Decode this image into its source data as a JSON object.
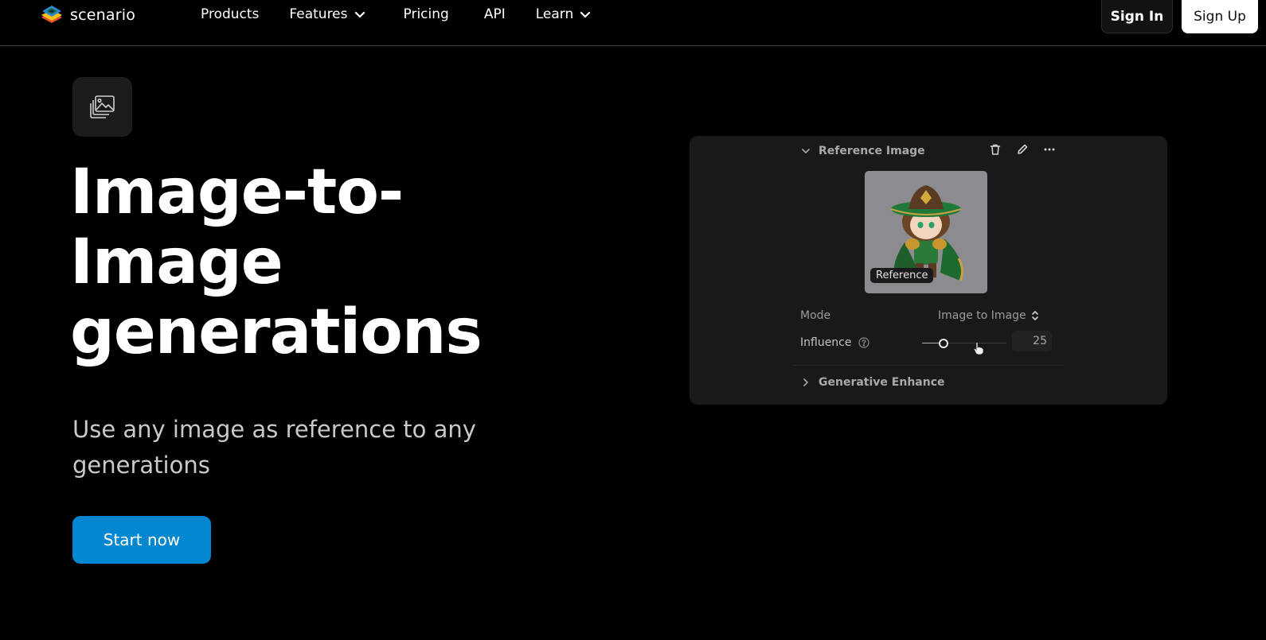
{
  "nav": {
    "brand": "scenario",
    "links": [
      {
        "label": "Products",
        "has_dropdown": false
      },
      {
        "label": "Features",
        "has_dropdown": true
      },
      {
        "label": "Pricing",
        "has_dropdown": false
      },
      {
        "label": "API",
        "has_dropdown": false
      },
      {
        "label": "Learn",
        "has_dropdown": true
      }
    ],
    "sign_in": "Sign In",
    "sign_up": "Sign Up"
  },
  "hero": {
    "feature_icon": "images-icon",
    "title": "Image-to-Image generations",
    "subtitle": "Use any image as reference to any generations",
    "cta": "Start now"
  },
  "preview": {
    "section_title": "Reference Image",
    "actions": [
      "trash-icon",
      "pencil-icon",
      "more-icon"
    ],
    "image_badge": "Reference",
    "mode_label": "Mode",
    "mode_value": "Image to Image",
    "influence_label": "Influence",
    "influence_value": "25",
    "influence_fraction": 0.25,
    "collapsed_section": "Generative Enhance"
  },
  "colors": {
    "accent": "#0287d0",
    "background": "#000000",
    "panel": "#19181b"
  }
}
